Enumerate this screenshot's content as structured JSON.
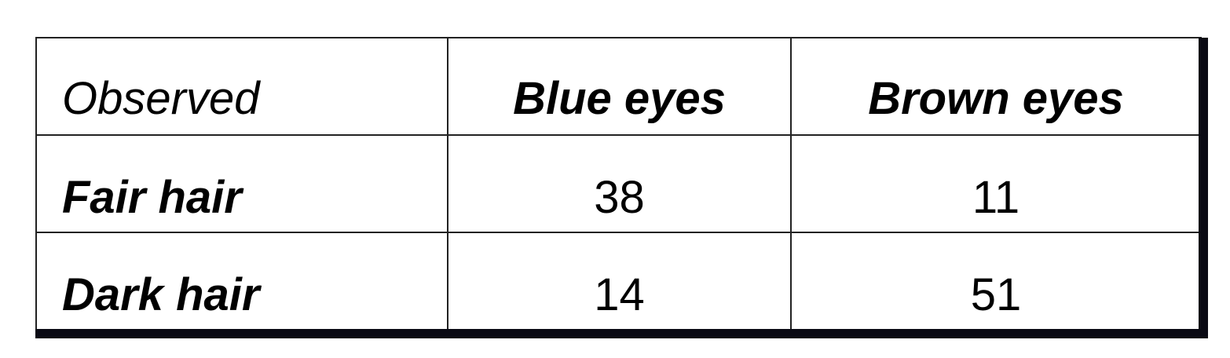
{
  "table": {
    "corner_label": "Observed",
    "columns": [
      "Blue eyes",
      "Brown eyes"
    ],
    "rows": [
      {
        "label": "Fair hair",
        "values": [
          "38",
          "11"
        ]
      },
      {
        "label": "Dark hair",
        "values": [
          "14",
          "51"
        ]
      }
    ]
  }
}
